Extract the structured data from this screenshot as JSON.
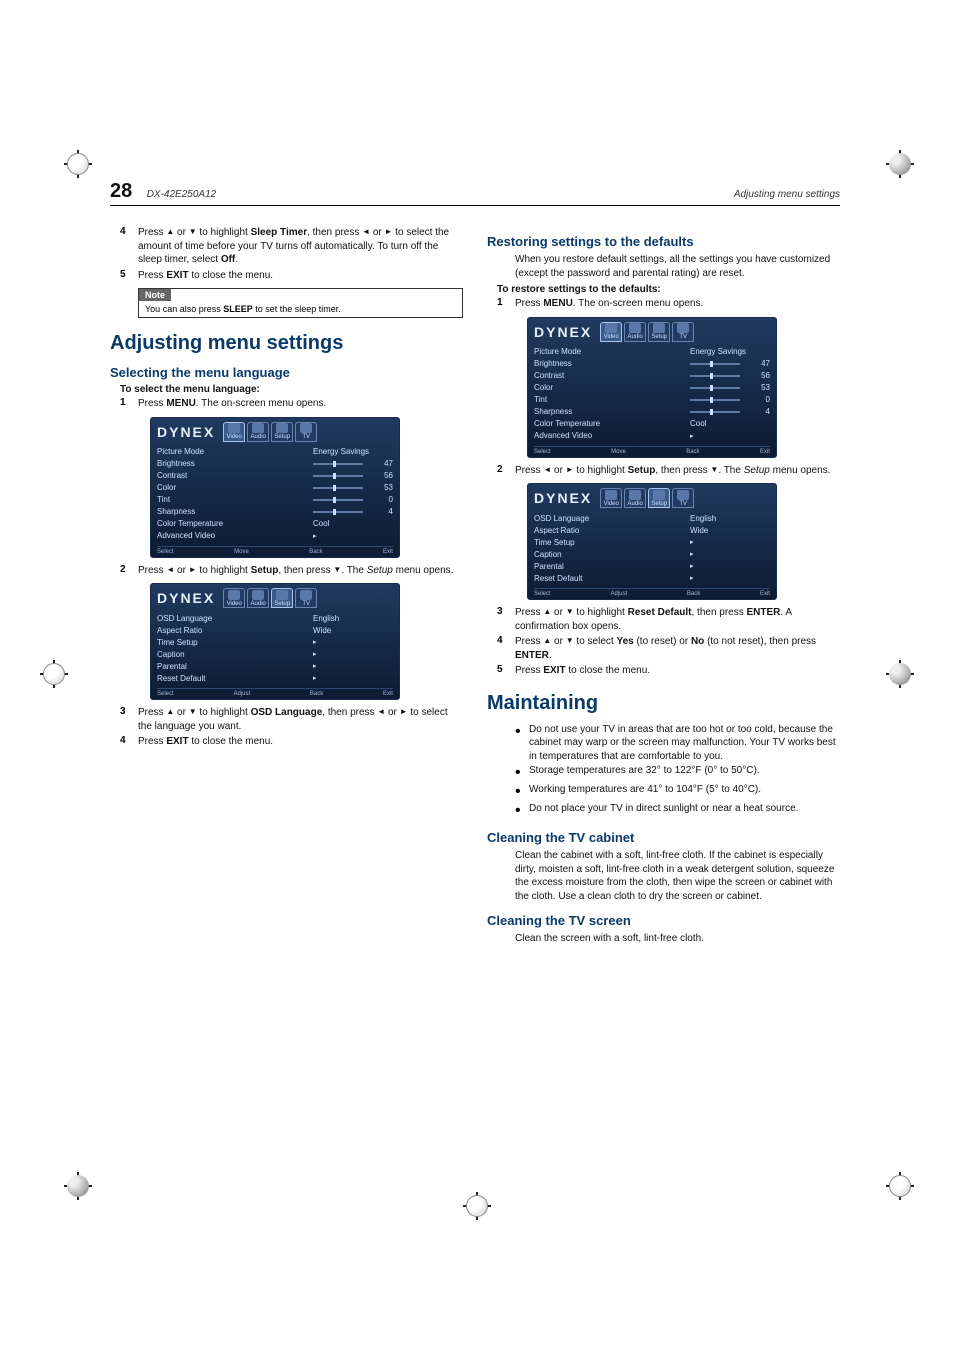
{
  "page": {
    "number": "28",
    "model": "DX-42E250A12",
    "section_top_right": "Adjusting menu settings"
  },
  "left": {
    "step4": {
      "pre": "Press ",
      "mid1": " or ",
      "mid2": " to highlight ",
      "bold1": "Sleep Timer",
      "mid3": ", then press ",
      "mid4": " or ",
      "post": " to select the amount of time before your TV turns off automatically. To turn off the sleep timer, select ",
      "bold2": "Off",
      "end": "."
    },
    "step5": {
      "pre": "Press ",
      "bold": "EXIT",
      "post": " to close the menu."
    },
    "note": {
      "label": "Note",
      "body_pre": "You can also press ",
      "body_bold": "SLEEP",
      "body_post": " to set the sleep timer."
    },
    "h1": "Adjusting menu settings",
    "h2": "Selecting the menu language",
    "h3": "To select the menu language:",
    "lang_step1": {
      "pre": "Press ",
      "bold": "MENU",
      "post": ". The on-screen menu opens."
    },
    "lang_step2": {
      "pre": "Press ",
      "mid1": " or ",
      "mid2": " to highlight ",
      "bold": "Setup",
      "mid3": ", then press ",
      "post": ". The ",
      "ital": "Setup",
      "end": " menu opens."
    },
    "lang_step3": {
      "pre": "Press ",
      "mid1": " or ",
      "mid2": " to highlight ",
      "bold": "OSD Language",
      "mid3": ", then press ",
      "mid4": " or ",
      "post": " to select the language you want."
    },
    "lang_step4": {
      "pre": "Press ",
      "bold": "EXIT",
      "post": " to close the menu."
    }
  },
  "right": {
    "h2a": "Restoring settings to the defaults",
    "intro": "When you restore default settings, all the settings you have customized (except the password and parental rating) are reset.",
    "h3a": "To restore settings to the defaults:",
    "rest_step1": {
      "pre": "Press ",
      "bold": "MENU",
      "post": ". The on-screen menu opens."
    },
    "rest_step2": {
      "pre": "Press ",
      "mid1": " or ",
      "mid2": " to highlight ",
      "bold": "Setup",
      "mid3": ", then press ",
      "post": ". The ",
      "ital": "Setup",
      "end": " menu opens."
    },
    "rest_step3": {
      "pre": "Press ",
      "mid1": " or ",
      "mid2": " to highlight ",
      "bold1": "Reset Default",
      "mid3": ", then press ",
      "bold2": "ENTER",
      "post": ". A confirmation box opens."
    },
    "rest_step4": {
      "pre": "Press ",
      "mid1": " or ",
      "mid2": " to select ",
      "bold1": "Yes",
      "mid3": " (to reset) or ",
      "bold2": "No",
      "mid4": " (to not reset), then press ",
      "bold3": "ENTER",
      "end": "."
    },
    "rest_step5": {
      "pre": "Press ",
      "bold": "EXIT",
      "post": " to close the menu."
    },
    "h1b": "Maintaining",
    "bullets": [
      "Do not use your TV in areas that are too hot or too cold, because the cabinet may warp or the screen may malfunction. Your TV works best in temperatures that are comfortable to you.",
      "Storage temperatures are 32° to 122°F (0° to 50°C).",
      "Working temperatures are 41° to 104°F (5° to 40°C).",
      "Do not place your TV in direct sunlight or near a heat source."
    ],
    "h2b": "Cleaning the TV cabinet",
    "cab_body": "Clean the cabinet with a soft, lint-free cloth. If the cabinet is especially dirty, moisten a soft, lint-free cloth in a weak detergent solution, squeeze the excess moisture from the cloth, then wipe the screen or cabinet with the cloth. Use a clean cloth to dry the screen or cabinet.",
    "h2c": "Cleaning the TV screen",
    "scr_body": "Clean the screen with a soft, lint-free cloth."
  },
  "osd_video": {
    "brand": "DYNEX",
    "tabs": [
      "Video",
      "Audio",
      "Setup",
      "TV"
    ],
    "rows": [
      {
        "label": "Picture Mode",
        "value": "Energy Savings"
      },
      {
        "label": "Brightness",
        "slider": true,
        "value": "47"
      },
      {
        "label": "Contrast",
        "slider": true,
        "value": "56"
      },
      {
        "label": "Color",
        "slider": true,
        "value": "53"
      },
      {
        "label": "Tint",
        "slider": true,
        "value": "0"
      },
      {
        "label": "Sharpness",
        "slider": true,
        "value": "4"
      },
      {
        "label": "Color Temperature",
        "value": "Cool"
      },
      {
        "label": "Advanced Video",
        "value": "▸"
      }
    ],
    "footer": [
      "Select",
      "Move",
      "Back",
      "Exit"
    ]
  },
  "osd_setup": {
    "brand": "DYNEX",
    "tabs": [
      "Video",
      "Audio",
      "Setup",
      "TV"
    ],
    "rows": [
      {
        "label": "OSD Language",
        "value": "English"
      },
      {
        "label": "Aspect Ratio",
        "value": "Wide"
      },
      {
        "label": "Time Setup",
        "value": "▸"
      },
      {
        "label": "Caption",
        "value": "▸"
      },
      {
        "label": "Parental",
        "value": "▸"
      },
      {
        "label": "Reset Default",
        "value": "▸"
      }
    ],
    "footer": [
      "Select",
      "Adjust",
      "Back",
      "Exit"
    ]
  },
  "glyph": {
    "up": "▲",
    "down": "▼",
    "left": "◄",
    "right": "►"
  }
}
